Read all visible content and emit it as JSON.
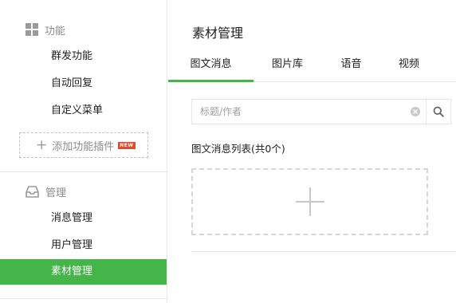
{
  "sidebar": {
    "sections": [
      {
        "label": "功能",
        "icon": "grid-icon",
        "items": [
          {
            "label": "群发功能"
          },
          {
            "label": "自动回复"
          },
          {
            "label": "自定义菜单"
          }
        ],
        "add_plugin": {
          "label": "添加功能插件",
          "badge": "NEW"
        }
      },
      {
        "label": "管理",
        "icon": "inbox-icon",
        "items": [
          {
            "label": "消息管理"
          },
          {
            "label": "用户管理"
          },
          {
            "label": "素材管理",
            "active": true
          }
        ]
      }
    ]
  },
  "main": {
    "title": "素材管理",
    "tabs": [
      {
        "label": "图文消息",
        "active": true
      },
      {
        "label": "图片库"
      },
      {
        "label": "语音"
      },
      {
        "label": "视频"
      }
    ],
    "search": {
      "placeholder": "标题/作者",
      "value": ""
    },
    "list_title": "图文消息列表(共0个)"
  },
  "colors": {
    "accent": "#44b549",
    "badge": "#e14a2c",
    "border": "#e7e7eb",
    "muted_text": "#8d8d8d"
  }
}
